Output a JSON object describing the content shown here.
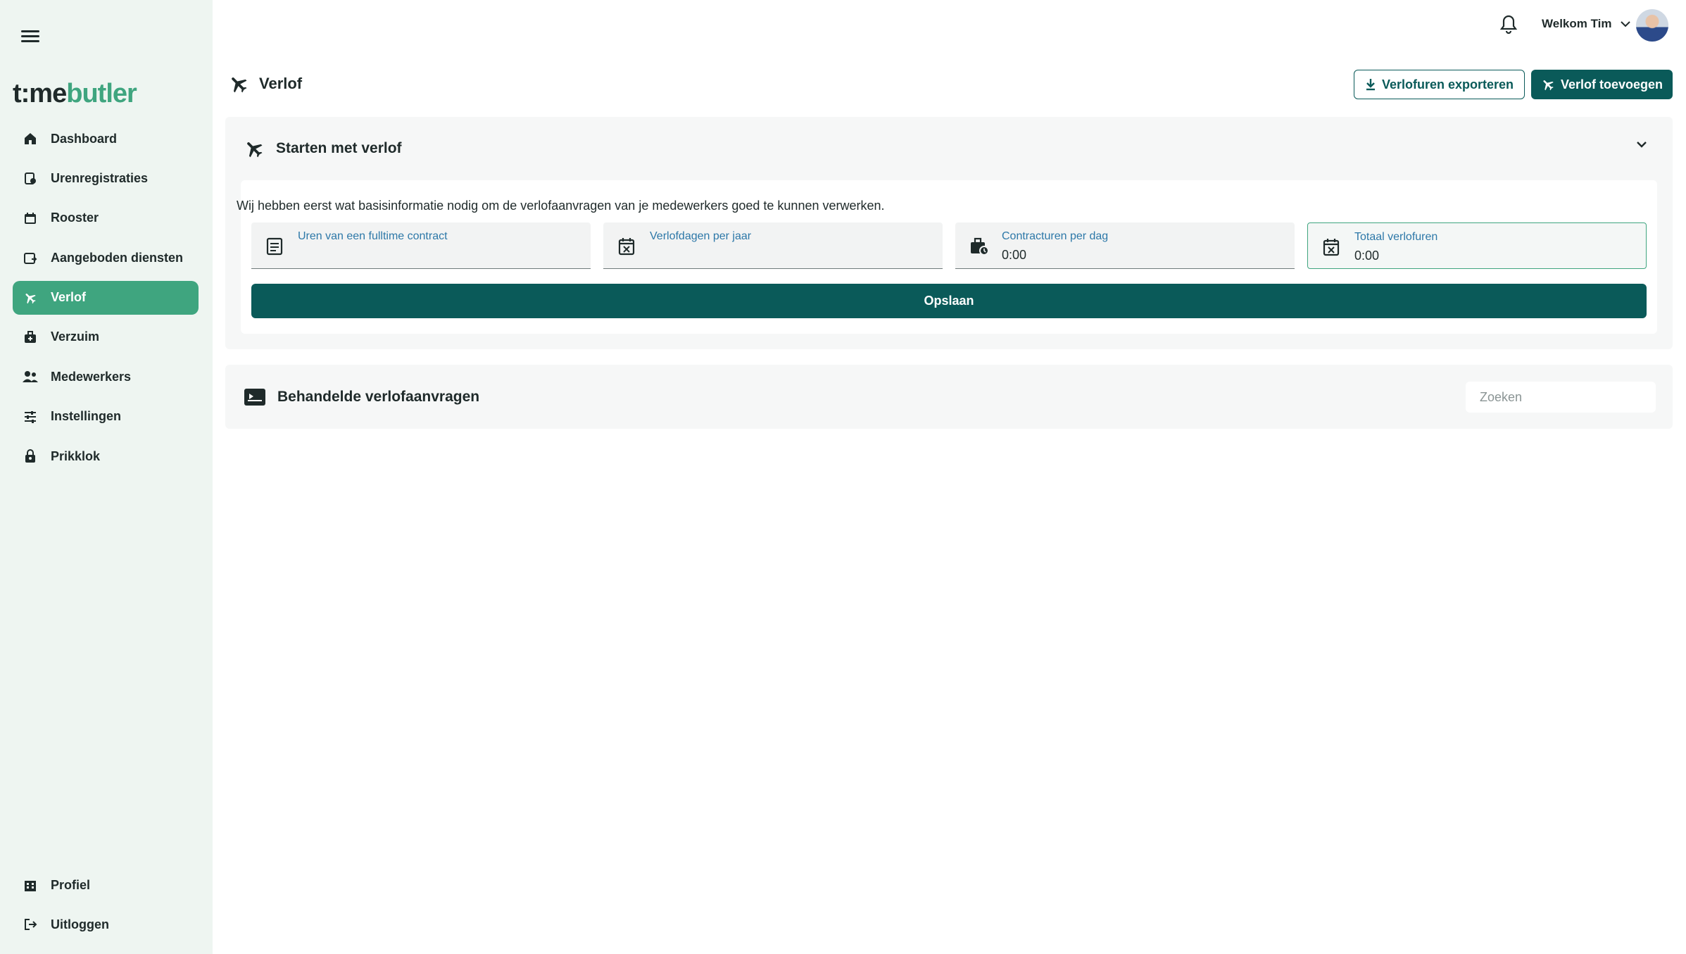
{
  "brand": {
    "logo_part1": "t:me",
    "logo_part2": "butler"
  },
  "sidebar": {
    "items": [
      {
        "label": "Dashboard",
        "icon": "home-icon"
      },
      {
        "label": "Urenregistraties",
        "icon": "time-register-icon"
      },
      {
        "label": "Rooster",
        "icon": "calendar-icon"
      },
      {
        "label": "Aangeboden diensten",
        "icon": "calendar-offer-icon"
      },
      {
        "label": "Verlof",
        "icon": "airplane-icon",
        "active": true
      },
      {
        "label": "Verzuim",
        "icon": "medical-bag-icon"
      },
      {
        "label": "Medewerkers",
        "icon": "people-icon"
      },
      {
        "label": "Instellingen",
        "icon": "sliders-icon"
      },
      {
        "label": "Prikklok",
        "icon": "lock-clock-icon"
      }
    ],
    "bottom_items": [
      {
        "label": "Profiel",
        "icon": "building-icon"
      },
      {
        "label": "Uitloggen",
        "icon": "logout-icon"
      }
    ]
  },
  "topbar": {
    "welcome": "Welkom Tim"
  },
  "page": {
    "title": "Verlof",
    "export_button": "Verlofuren exporteren",
    "add_button": "Verlof toevoegen"
  },
  "start_panel": {
    "title": "Starten met verlof",
    "intro": "Wij hebben eerst wat basisinformatie nodig om de verlofaanvragen van je medewerkers goed te kunnen verwerken.",
    "fields": [
      {
        "label": "Uren van een fulltime contract",
        "value": ""
      },
      {
        "label": "Verlofdagen per jaar",
        "value": ""
      },
      {
        "label": "Contracturen per dag",
        "value": "0:00"
      },
      {
        "label": "Totaal verlofuren",
        "value": "0:00"
      }
    ],
    "save_button": "Opslaan"
  },
  "handled_panel": {
    "title": "Behandelde verlofaanvragen",
    "search_placeholder": "Zoeken"
  },
  "colors": {
    "accent": "#3fa57f",
    "primary": "#0a5a59",
    "sidebar_bg": "#eef5f1",
    "label_blue": "#2d78a8"
  }
}
